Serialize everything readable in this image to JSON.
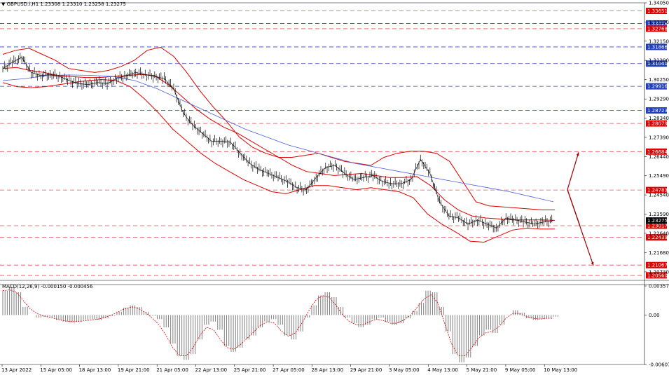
{
  "header": {
    "symbol_label": "GBPUSD.i,H1",
    "ohlc": "1.23308 1.23310 1.23258 1.23275"
  },
  "macd_header": {
    "label": "MACD(12,26,9) -0.000150 -0.000456"
  },
  "colors": {
    "background": "#ffffff",
    "price_bar": "#000000",
    "bollinger": "#e00000",
    "moving_average": "#4a5fe0",
    "resistance_line": "#e05050",
    "support_line_blue": "#3040c0",
    "red_label_bg": "#e00000",
    "blue_label_bg": "#1f3fbf",
    "arrow": "#a00000",
    "macd_hist": "#808080",
    "macd_signal": "#e00000"
  },
  "chart_data": {
    "type": "line",
    "price_axis": {
      "ylim": [
        1.2038,
        1.3405
      ],
      "ticks": [
        "1.34050",
        "1.33100",
        "1.32150",
        "1.31200",
        "1.30250",
        "1.29290",
        "1.28340",
        "1.27390",
        "1.26440",
        "1.25490",
        "1.24540",
        "1.23590",
        "1.22640",
        "1.21680",
        "1.20730"
      ]
    },
    "current_price_label": "1.23275",
    "horizontal_levels": [
      {
        "value": "1.33651",
        "color": "red"
      },
      {
        "value": "1.33028",
        "color": "blue"
      },
      {
        "value": "1.32768",
        "color": "red"
      },
      {
        "value": "1.31866",
        "color": "blue"
      },
      {
        "value": "1.31041",
        "color": "blue"
      },
      {
        "value": "1.29916",
        "color": "blue"
      },
      {
        "value": "1.28723",
        "color": "blue"
      },
      {
        "value": "1.28079",
        "color": "red"
      },
      {
        "value": "1.26684",
        "color": "red"
      },
      {
        "value": "1.24783",
        "color": "red"
      },
      {
        "value": "1.23017",
        "color": "red"
      },
      {
        "value": "1.22439",
        "color": "red"
      },
      {
        "value": "1.21067",
        "color": "red"
      },
      {
        "value": "1.20560",
        "color": "red"
      }
    ],
    "x_labels": [
      "13 Apr 2022",
      "15 Apr 05:00",
      "18 Apr 13:00",
      "19 Apr 21:00",
      "21 Apr 05:00",
      "22 Apr 13:00",
      "25 Apr 21:00",
      "27 Apr 05:00",
      "28 Apr 13:00",
      "29 Apr 21:00",
      "3 May 05:00",
      "4 May 13:00",
      "5 May 21:00",
      "9 May 05:00",
      "10 May 13:00"
    ],
    "close": [
      1.308,
      1.311,
      1.3135,
      1.306,
      1.3045,
      1.305,
      1.304,
      1.302,
      1.3005,
      1.3,
      1.301,
      1.3005,
      1.303,
      1.3045,
      1.306,
      1.305,
      1.304,
      1.303,
      1.298,
      1.286,
      1.28,
      1.276,
      1.272,
      1.272,
      1.2715,
      1.266,
      1.261,
      1.258,
      1.256,
      1.254,
      1.252,
      1.249,
      1.248,
      1.254,
      1.259,
      1.26,
      1.256,
      1.253,
      1.254,
      1.255,
      1.252,
      1.251,
      1.251,
      1.253,
      1.263,
      1.256,
      1.242,
      1.235,
      1.234,
      1.231,
      1.233,
      1.231,
      1.229,
      1.234,
      1.233,
      1.232,
      1.231,
      1.232,
      1.2327
    ],
    "bb_upper": [
      1.315,
      1.317,
      1.318,
      1.315,
      1.312,
      1.308,
      1.307,
      1.306,
      1.307,
      1.309,
      1.312,
      1.317,
      1.3185,
      1.314,
      1.306,
      1.297,
      1.289,
      1.282,
      1.274,
      1.269,
      1.266,
      1.264,
      1.264,
      1.265,
      1.266,
      1.264,
      1.262,
      1.261,
      1.26,
      1.264,
      1.266,
      1.267,
      1.267,
      1.266,
      1.262,
      1.252,
      1.242,
      1.24,
      1.2395,
      1.239,
      1.2385,
      1.238,
      1.238
    ],
    "bb_middle": [
      1.308,
      1.3085,
      1.307,
      1.306,
      1.3045,
      1.304,
      1.3035,
      1.3035,
      1.304,
      1.3045,
      1.305,
      1.3045,
      1.3,
      1.294,
      1.288,
      1.283,
      1.279,
      1.276,
      1.272,
      1.268,
      1.264,
      1.26,
      1.257,
      1.256,
      1.255,
      1.2555,
      1.256,
      1.255,
      1.254,
      1.254,
      1.2545,
      1.25,
      1.243,
      1.238,
      1.235,
      1.234,
      1.2335,
      1.233,
      1.233,
      1.233,
      1.2328
    ],
    "bb_lower": [
      1.301,
      1.299,
      1.2985,
      1.299,
      1.3,
      1.301,
      1.302,
      1.3025,
      1.302,
      1.299,
      1.293,
      1.286,
      1.278,
      1.272,
      1.266,
      1.261,
      1.257,
      1.253,
      1.25,
      1.247,
      1.246,
      1.248,
      1.25,
      1.25,
      1.249,
      1.248,
      1.249,
      1.248,
      1.247,
      1.244,
      1.236,
      1.231,
      1.227,
      1.2225,
      1.222,
      1.225,
      1.228,
      1.229,
      1.2285,
      1.2285
    ],
    "moving_average": [
      1.302,
      1.303,
      1.3045,
      1.3048,
      1.3046,
      1.304,
      1.302,
      1.298,
      1.293,
      1.288,
      1.283,
      1.278,
      1.274,
      1.27,
      1.267,
      1.264,
      1.261,
      1.259,
      1.257,
      1.255,
      1.253,
      1.251,
      1.249,
      1.247,
      1.2445,
      1.242
    ],
    "macd_axis": {
      "ylim": [
        -0.006072,
        0.003575
      ],
      "ticks": [
        "0.003575",
        "0.00",
        "-0.006072"
      ]
    },
    "macd_hist": [
      0.003,
      0.0035,
      0.0028,
      0.001,
      0.0,
      -0.0003,
      -0.0002,
      -0.0003,
      -0.0006,
      -0.0008,
      -0.0009,
      -0.0008,
      -0.0006,
      -0.0005,
      -0.0006,
      -0.0004,
      -0.0001,
      0.0004,
      0.0009,
      0.0012,
      0.001,
      0.0004,
      -0.0001,
      -0.0005,
      -0.0015,
      -0.0035,
      -0.005,
      -0.0055,
      -0.0048,
      -0.003,
      -0.0012,
      -0.0008,
      -0.0018,
      -0.0038,
      -0.0045,
      -0.004,
      -0.003,
      -0.0025,
      -0.0015,
      -0.0008,
      -0.0005,
      -0.0012,
      -0.0025,
      -0.003,
      -0.002,
      -0.0003,
      0.0012,
      0.0024,
      0.0028,
      0.0022,
      0.001,
      -0.0003,
      -0.001,
      -0.0015,
      -0.0012,
      -0.0005,
      -0.0003,
      -0.0008,
      -0.0012,
      -0.001,
      -0.0004,
      0.0005,
      0.0015,
      0.003,
      0.0028,
      0.001,
      -0.002,
      -0.0048,
      -0.0058,
      -0.0052,
      -0.0038,
      -0.0025,
      -0.0018,
      -0.0022,
      -0.0012,
      0.0,
      0.0006,
      0.0003,
      -0.0004,
      -0.0006,
      -0.0005,
      -0.0004,
      -0.0002
    ],
    "macd_signal": [
      0.003,
      0.0031,
      0.0028,
      0.0018,
      0.0008,
      0.0002,
      -0.0001,
      -0.0003,
      -0.0005,
      -0.0007,
      -0.0008,
      -0.0008,
      -0.0007,
      -0.0006,
      -0.0005,
      -0.0003,
      0.0,
      0.0004,
      0.0008,
      0.001,
      0.0008,
      0.0003,
      -0.0004,
      -0.0012,
      -0.0025,
      -0.004,
      -0.005,
      -0.005,
      -0.004,
      -0.0025,
      -0.0015,
      -0.0018,
      -0.003,
      -0.004,
      -0.0042,
      -0.0036,
      -0.0028,
      -0.002,
      -0.0012,
      -0.0008,
      -0.001,
      -0.002,
      -0.0026,
      -0.0022,
      -0.001,
      0.0005,
      0.0018,
      0.0024,
      0.0022,
      0.0012,
      0.0,
      -0.0008,
      -0.0012,
      -0.0012,
      -0.0008,
      -0.0005,
      -0.0007,
      -0.001,
      -0.001,
      -0.0006,
      0.0,
      0.001,
      0.002,
      0.0025,
      0.0015,
      -0.001,
      -0.0035,
      -0.005,
      -0.005,
      -0.004,
      -0.0028,
      -0.0022,
      -0.002,
      -0.0014,
      -0.0004,
      0.0002,
      0.0002,
      -0.0002,
      -0.0004,
      -0.0005,
      -0.0004,
      -0.0004
    ],
    "forecast_arrows": {
      "origin": [
        1.248
      ],
      "up_target": 1.2665,
      "down_target": 1.2105
    }
  }
}
